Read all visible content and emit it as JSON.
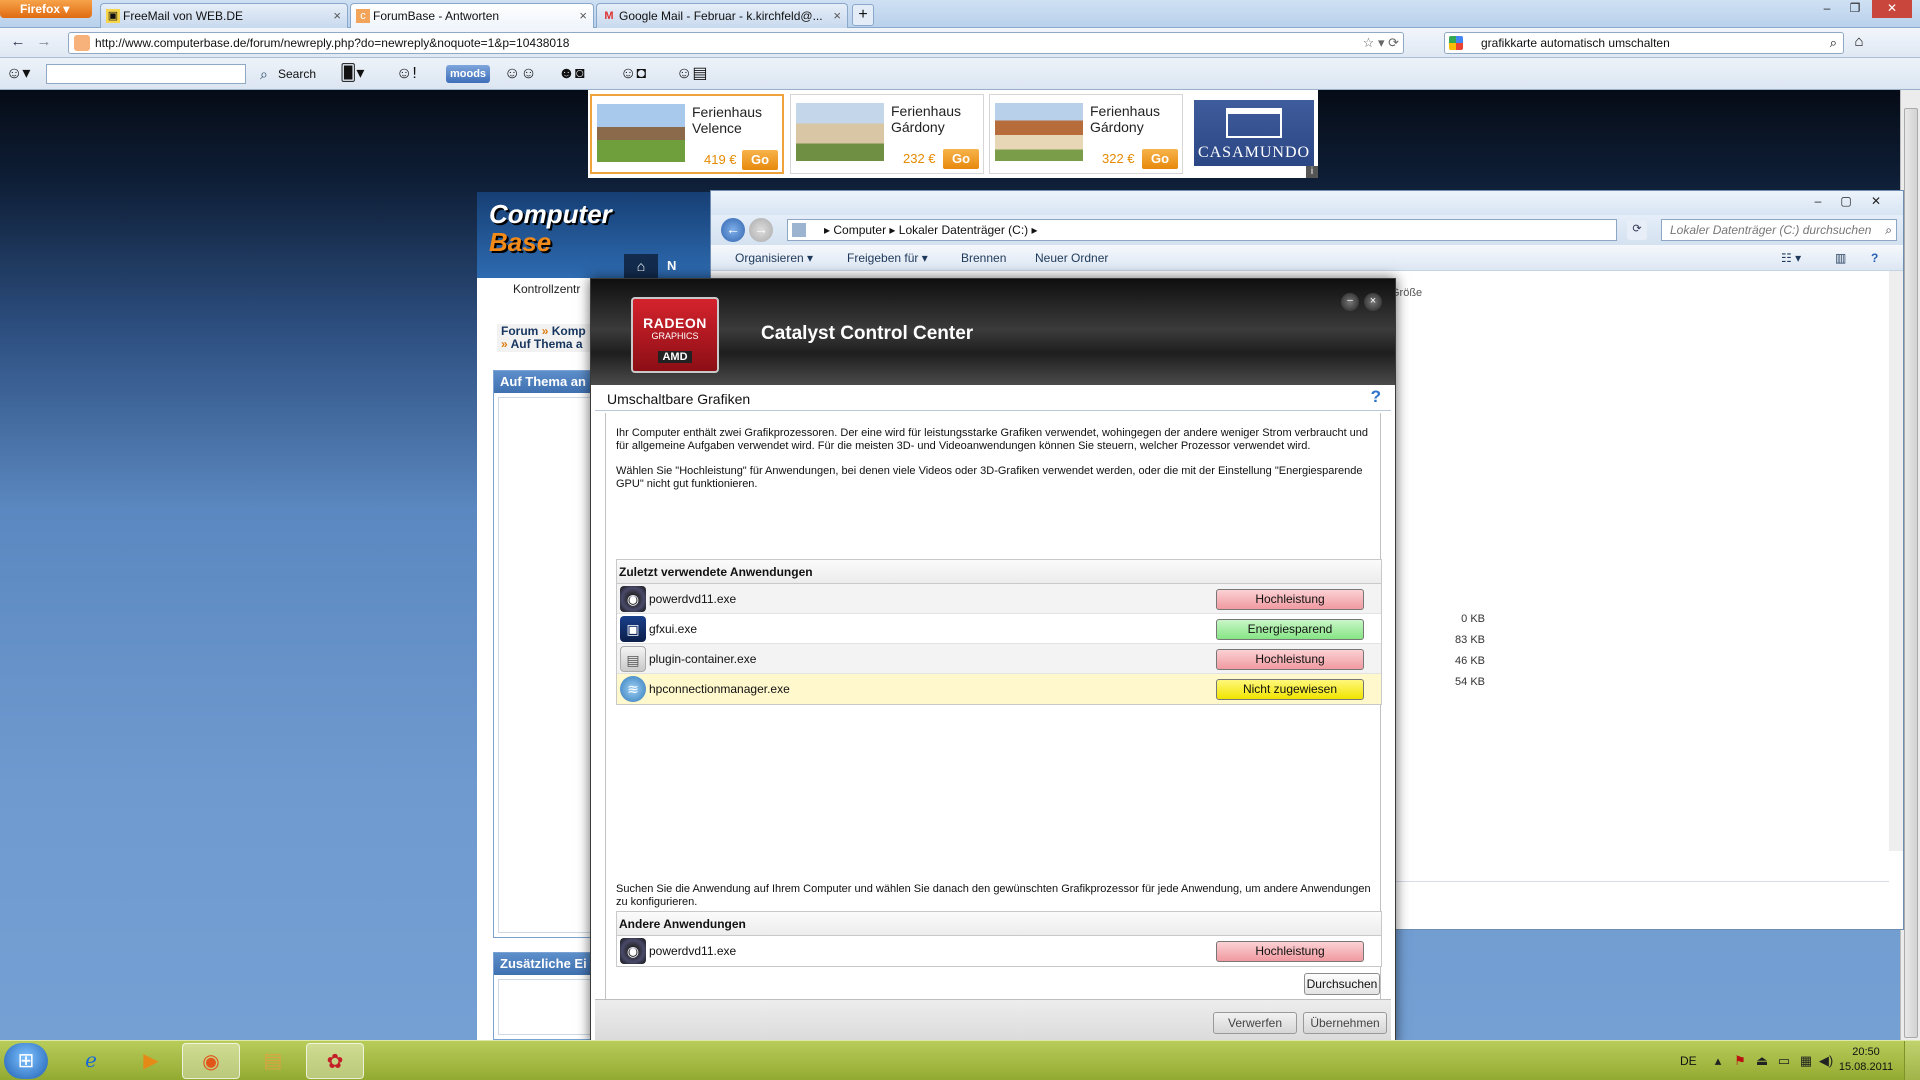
{
  "browser": {
    "menu_label": "Firefox",
    "tabs": [
      {
        "title": "FreeMail von WEB.DE",
        "icon": "webde-favicon"
      },
      {
        "title": "ForumBase - Antworten",
        "icon": "computerbase-favicon"
      },
      {
        "title": "Google Mail - Februar - k.kirchfeld@...",
        "icon": "gmail-favicon"
      }
    ],
    "url": "http://www.computerbase.de/forum/newreply.php?do=newreply&noquote=1&p=10438018",
    "search_query": "grafikkarte automatisch umschalten",
    "toolbar_search_label": "Search",
    "toolbar_moods_label": "moods"
  },
  "ads": [
    {
      "name": "Ferienhaus Velence",
      "price": "419 €",
      "go": "Go"
    },
    {
      "name": "Ferienhaus Gárdony",
      "price": "232 €",
      "go": "Go"
    },
    {
      "name": "Ferienhaus Gárdony",
      "price": "322 €",
      "go": "Go"
    }
  ],
  "ad_logo": "CASAMUNDO",
  "ad_info": "i",
  "forum": {
    "logo_line1": "Computer",
    "logo_line2": "Base",
    "tab_n": "N",
    "kontroll": "Kontrollzentr",
    "breadcrumb_1": "Forum",
    "breadcrumb_2": "Komp",
    "breadcrumb_3": "Auf Thema a",
    "box1_caption": "Auf Thema an",
    "box2_caption": "Zusätzliche Ei"
  },
  "explorer": {
    "path": [
      "Computer",
      "Lokaler Datenträger (C:)"
    ],
    "search_placeholder": "Lokaler Datenträger (C:) durchsuchen",
    "toolbar": [
      "Organisieren",
      "Freigeben für",
      "Brennen",
      "Neuer Ordner"
    ],
    "column_header": "Größe",
    "sizes": [
      "0 KB",
      "83 KB",
      "46 KB",
      "54 KB"
    ]
  },
  "ccc": {
    "brand_line1": "RADEON",
    "brand_line2": "GRAPHICS",
    "brand_line3": "AMD",
    "title": "Catalyst Control Center",
    "panel_title": "Umschaltbare Grafiken",
    "help": "?",
    "desc1": "Ihr Computer enthält zwei Grafikprozessoren. Der eine wird für leistungsstarke Grafiken verwendet, wohingegen der andere weniger Strom verbraucht und für allgemeine Aufgaben verwendet wird. Für die meisten 3D- und Videoanwendungen können Sie steuern, welcher Prozessor verwendet wird.",
    "desc2": "Wählen Sie \"Hochleistung\" für Anwendungen, bei denen viele Videos oder 3D-Grafiken verwendet werden, oder die mit der Einstellung \"Energiesparende GPU\" nicht gut funktionieren.",
    "recent_header": "Zuletzt verwendete Anwendungen",
    "recent_apps": [
      {
        "name": "powerdvd11.exe",
        "gpu": "Hochleistung",
        "icon": "powerdvd-icon"
      },
      {
        "name": "gfxui.exe",
        "gpu": "Energiesparend",
        "icon": "gfxui-icon"
      },
      {
        "name": "plugin-container.exe",
        "gpu": "Hochleistung",
        "icon": "plugin-container-icon"
      },
      {
        "name": "hpconnectionmanager.exe",
        "gpu": "Nicht zugewiesen",
        "icon": "wireless-icon"
      }
    ],
    "search_desc": "Suchen Sie die Anwendung auf Ihrem Computer und wählen Sie danach den gewünschten Grafikprozessor für jede Anwendung, um andere Anwendungen zu konfigurieren.",
    "other_header": "Andere Anwendungen",
    "other_apps": [
      {
        "name": "powerdvd11.exe",
        "gpu": "Hochleistung",
        "icon": "powerdvd-icon"
      }
    ],
    "browse_label": "Durchsuchen",
    "discard_label": "Verwerfen",
    "apply_label": "Übernehmen"
  },
  "taskbar": {
    "lang": "DE",
    "time": "20:50",
    "date": "15.08.2011"
  },
  "colors": {
    "gpu_high": "#f09aa0",
    "gpu_eco": "#86e585",
    "gpu_none": "#f0e400",
    "amd_red": "#d5232d"
  }
}
